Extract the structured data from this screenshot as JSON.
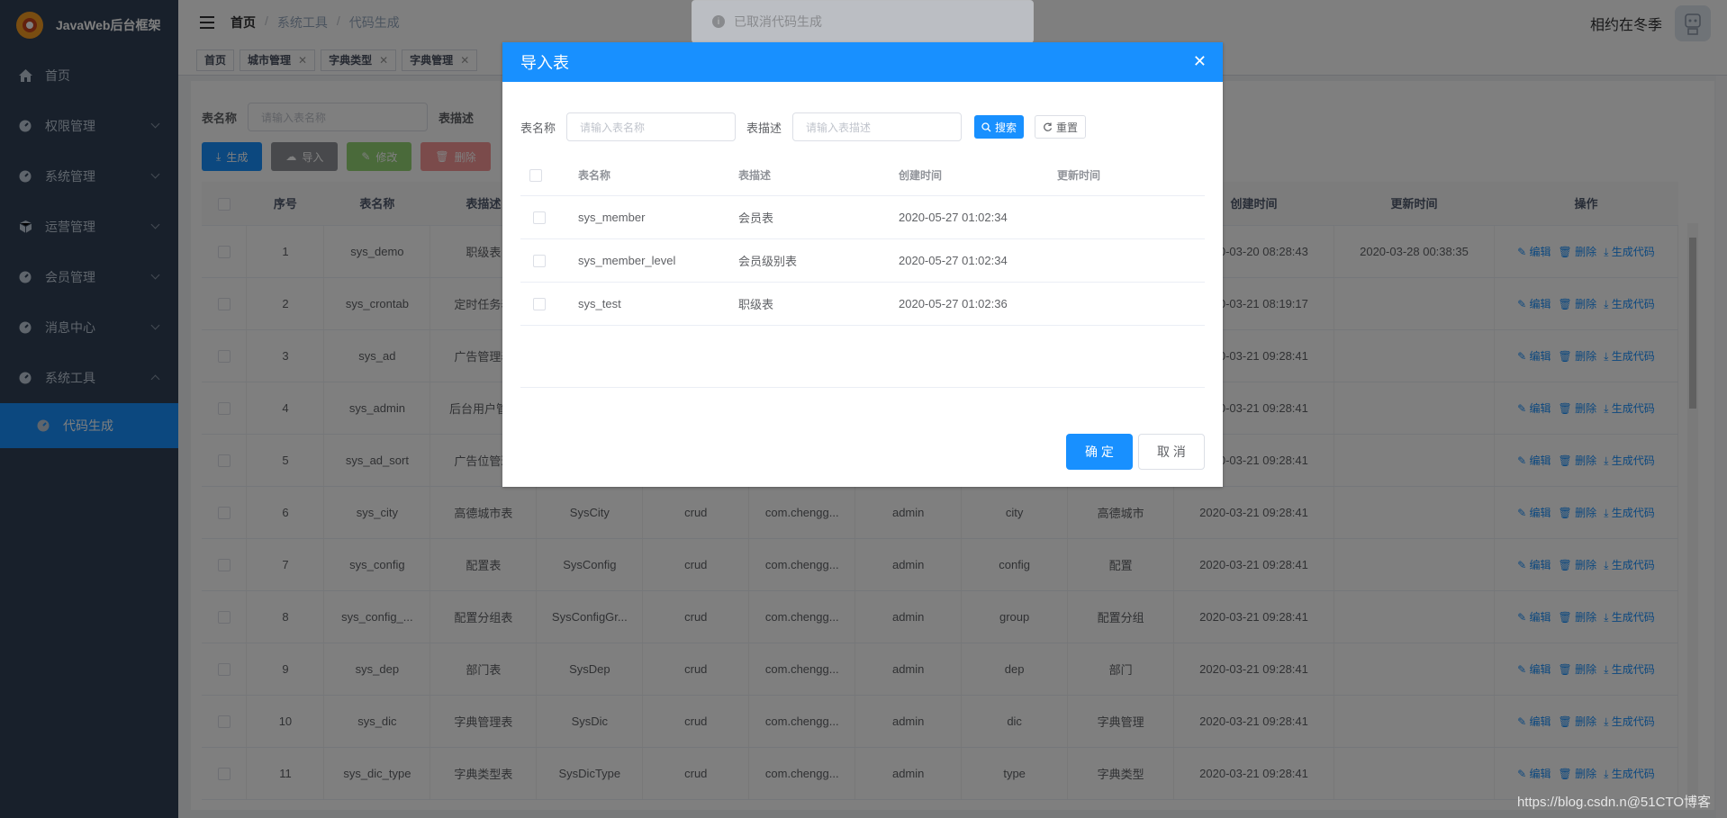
{
  "app": {
    "title": "JavaWeb后台框架"
  },
  "sidebar": {
    "items": [
      {
        "label": "首页",
        "icon": "home-icon"
      },
      {
        "label": "权限管理",
        "icon": "dashboard-icon"
      },
      {
        "label": "系统管理",
        "icon": "dashboard-icon"
      },
      {
        "label": "运营管理",
        "icon": "cube-icon"
      },
      {
        "label": "会员管理",
        "icon": "dashboard-icon"
      },
      {
        "label": "消息中心",
        "icon": "dashboard-icon"
      },
      {
        "label": "系统工具",
        "icon": "dashboard-icon"
      }
    ],
    "sub_item": "代码生成"
  },
  "breadcrumb": [
    "首页",
    "系统工具",
    "代码生成"
  ],
  "user": {
    "name": "相约在冬季"
  },
  "tags": [
    {
      "label": "首页",
      "closable": false
    },
    {
      "label": "城市管理",
      "closable": true
    },
    {
      "label": "字典类型",
      "closable": true
    },
    {
      "label": "字典管理",
      "closable": true
    }
  ],
  "search": {
    "table_name_label": "表名称",
    "table_name_placeholder": "请输入表名称",
    "table_desc_label": "表描述"
  },
  "toolbar": {
    "generate": "生成",
    "import": "导入",
    "edit": "修改",
    "delete": "删除"
  },
  "table": {
    "columns": [
      "序号",
      "表名称",
      "表描述",
      "创建时间",
      "更新时间",
      "操作"
    ],
    "rows": [
      [
        "1",
        "sys_demo",
        "职级表",
        "",
        "",
        "",
        "",
        "",
        "",
        "2020-03-20 08:28:43",
        "2020-03-28 00:38:35"
      ],
      [
        "2",
        "sys_crontab",
        "定时任务表",
        "",
        "",
        "",
        "",
        "",
        "",
        "2020-03-21 08:19:17",
        ""
      ],
      [
        "3",
        "sys_ad",
        "广告管理表",
        "",
        "",
        "",
        "",
        "",
        "",
        "2020-03-21 09:28:41",
        ""
      ],
      [
        "4",
        "sys_admin",
        "后台用户管...",
        "",
        "",
        "",
        "",
        "",
        "",
        "2020-03-21 09:28:41",
        ""
      ],
      [
        "5",
        "sys_ad_sort",
        "广告位管理",
        "",
        "",
        "",
        "",
        "",
        "",
        "2020-03-21 09:28:41",
        ""
      ],
      [
        "6",
        "sys_city",
        "高德城市表",
        "SysCity",
        "crud",
        "com.chengg...",
        "admin",
        "city",
        "高德城市",
        "2020-03-21 09:28:41",
        ""
      ],
      [
        "7",
        "sys_config",
        "配置表",
        "SysConfig",
        "crud",
        "com.chengg...",
        "admin",
        "config",
        "配置",
        "2020-03-21 09:28:41",
        ""
      ],
      [
        "8",
        "sys_config_...",
        "配置分组表",
        "SysConfigGr...",
        "crud",
        "com.chengg...",
        "admin",
        "group",
        "配置分组",
        "2020-03-21 09:28:41",
        ""
      ],
      [
        "9",
        "sys_dep",
        "部门表",
        "SysDep",
        "crud",
        "com.chengg...",
        "admin",
        "dep",
        "部门",
        "2020-03-21 09:28:41",
        ""
      ],
      [
        "10",
        "sys_dic",
        "字典管理表",
        "SysDic",
        "crud",
        "com.chengg...",
        "admin",
        "dic",
        "字典管理",
        "2020-03-21 09:28:41",
        ""
      ],
      [
        "11",
        "sys_dic_type",
        "字典类型表",
        "SysDicType",
        "crud",
        "com.chengg...",
        "admin",
        "type",
        "字典类型",
        "2020-03-21 09:28:41",
        ""
      ]
    ],
    "ops": {
      "edit": "编辑",
      "delete": "删除",
      "gen": "生成代码"
    }
  },
  "toast": {
    "text": "已取消代码生成"
  },
  "dialog": {
    "title": "导入表",
    "name_label": "表名称",
    "name_placeholder": "请输入表名称",
    "desc_label": "表描述",
    "desc_placeholder": "请输入表描述",
    "search_btn": "搜索",
    "reset_btn": "重置",
    "columns": [
      "表名称",
      "表描述",
      "创建时间",
      "更新时间"
    ],
    "rows": [
      [
        "sys_member",
        "会员表",
        "2020-05-27 01:02:34",
        ""
      ],
      [
        "sys_member_level",
        "会员级别表",
        "2020-05-27 01:02:34",
        ""
      ],
      [
        "sys_test",
        "职级表",
        "2020-05-27 01:02:36",
        ""
      ]
    ],
    "ok": "确 定",
    "cancel": "取 消"
  },
  "watermark": "https://blog.csdn.n@51CTO博客"
}
